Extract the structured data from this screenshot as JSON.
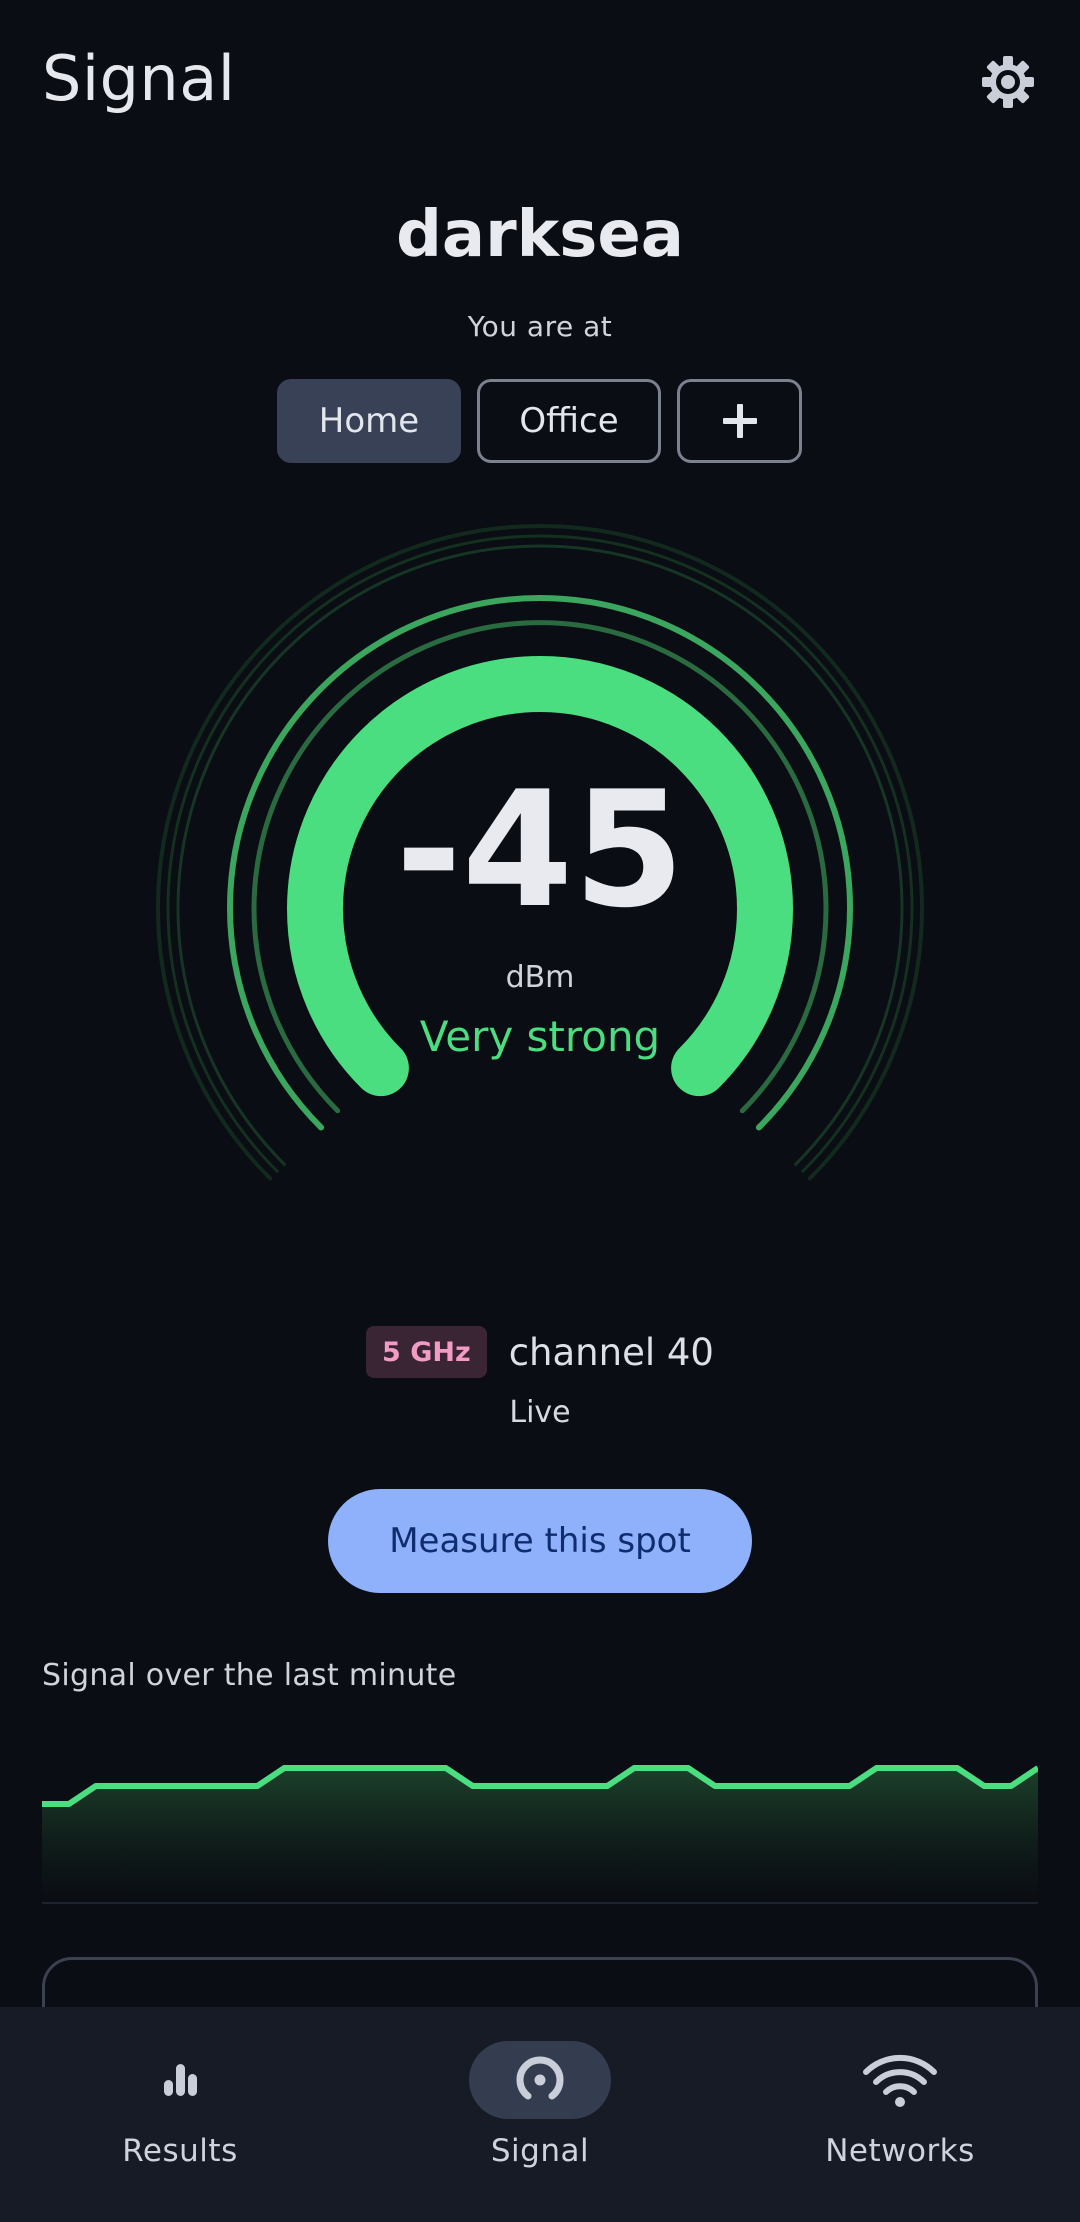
{
  "app": {
    "title": "Signal"
  },
  "header": {
    "settings_icon": "gear-icon"
  },
  "network": {
    "name": "darksea",
    "location_caption": "You are at",
    "locations": [
      {
        "label": "Home",
        "active": true
      },
      {
        "label": "Office",
        "active": false
      }
    ],
    "add_location_icon": "plus-icon"
  },
  "gauge": {
    "value": "-45",
    "unit": "dBm",
    "quality": "Very strong",
    "level_fraction": 1.0,
    "color": "#4ade80"
  },
  "connection": {
    "band": "5 GHz",
    "channel": "channel 40",
    "status": "Live",
    "band_color": "#f29bc4"
  },
  "actions": {
    "measure_label": "Measure this spot",
    "button_color": "#8fb0fb"
  },
  "history": {
    "title": "Signal over the last minute",
    "levels": [
      3,
      3,
      4,
      4,
      4,
      4,
      4,
      4,
      4,
      5,
      5,
      5,
      5,
      5,
      5,
      5,
      4,
      4,
      4,
      4,
      4,
      4,
      5,
      5,
      5,
      4,
      4,
      4,
      4,
      4,
      4,
      5,
      5,
      5,
      5,
      4,
      4,
      5
    ]
  },
  "bottom_nav": {
    "items": [
      {
        "label": "Results",
        "icon": "bar-chart-icon",
        "active": false
      },
      {
        "label": "Signal",
        "icon": "signal-gauge-icon",
        "active": true
      },
      {
        "label": "Networks",
        "icon": "wifi-icon",
        "active": false
      }
    ]
  }
}
